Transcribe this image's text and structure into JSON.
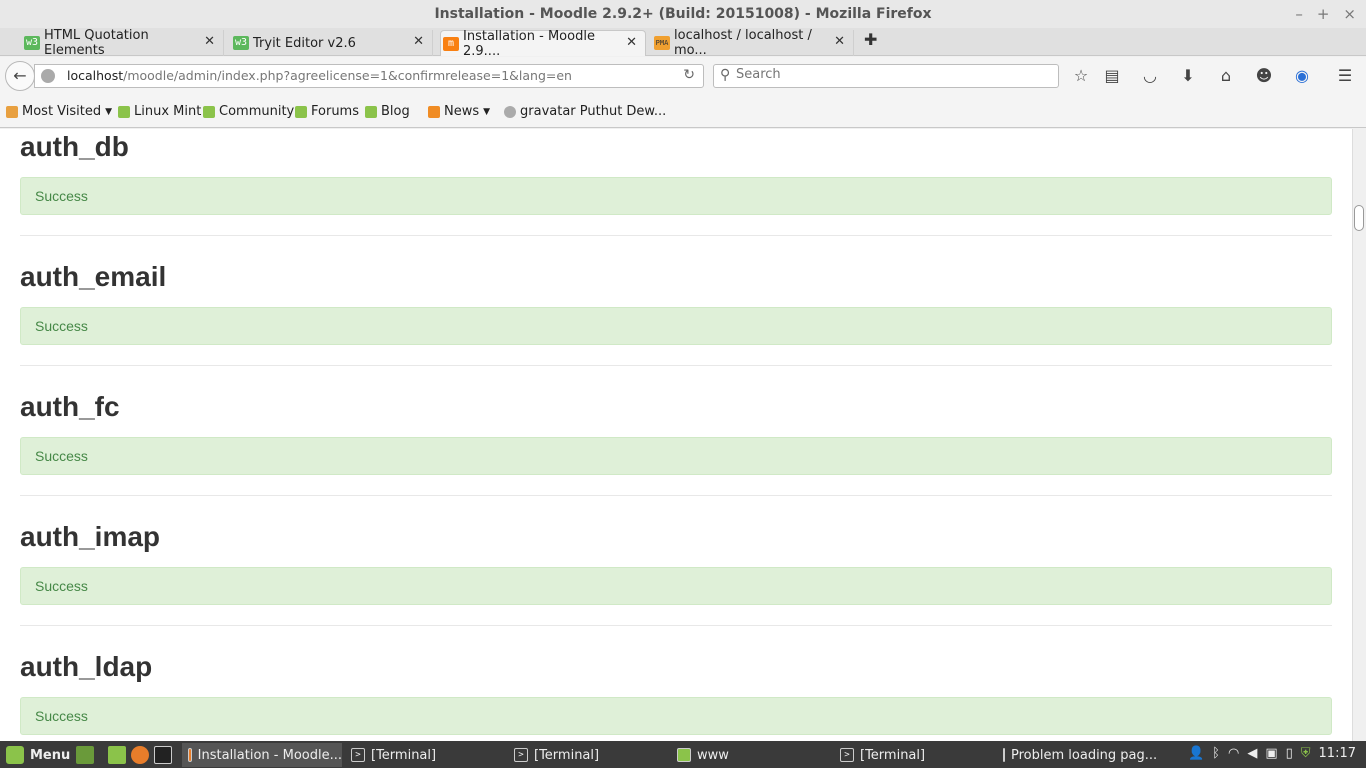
{
  "window": {
    "title": "Installation - Moodle 2.9.2+ (Build: 20151008) - Mozilla Firefox"
  },
  "tabs": [
    {
      "label": "HTML Quotation Elements",
      "icon": "w3-icon"
    },
    {
      "label": "Tryit Editor v2.6",
      "icon": "w3-icon"
    },
    {
      "label": "Installation - Moodle 2.9....",
      "icon": "moodle-icon"
    },
    {
      "label": "localhost / localhost / mo...",
      "icon": "phpmyadmin-icon"
    }
  ],
  "navbar": {
    "url_host": "localhost",
    "url_path": "/moodle/admin/index.php?agreelicense=1&confirmrelease=1&lang=en",
    "search_placeholder": "Search"
  },
  "bookmarks": [
    {
      "label": "Most Visited",
      "icon": "most-visited-icon",
      "dropdown": true
    },
    {
      "label": "Linux Mint",
      "icon": "mint-icon"
    },
    {
      "label": "Community",
      "icon": "mint-icon"
    },
    {
      "label": "Forums",
      "icon": "mint-icon"
    },
    {
      "label": "Blog",
      "icon": "mint-icon"
    },
    {
      "label": "News",
      "icon": "rss-icon",
      "dropdown": true
    },
    {
      "label": "gravatar Puthut Dew...",
      "icon": "globe-icon"
    }
  ],
  "sections": [
    {
      "heading": "auth_db",
      "status": "Success"
    },
    {
      "heading": "auth_email",
      "status": "Success"
    },
    {
      "heading": "auth_fc",
      "status": "Success"
    },
    {
      "heading": "auth_imap",
      "status": "Success"
    },
    {
      "heading": "auth_ldap",
      "status": "Success"
    }
  ],
  "taskbar": {
    "menu_label": "Menu",
    "tasks": [
      {
        "label": "Installation - Moodle...",
        "icon": "firefox-icon"
      },
      {
        "label": "[Terminal]",
        "icon": "terminal-icon"
      },
      {
        "label": "[Terminal]",
        "icon": "terminal-icon"
      },
      {
        "label": "www",
        "icon": "folder-icon"
      },
      {
        "label": "[Terminal]",
        "icon": "terminal-icon"
      },
      {
        "label": "Problem loading pag...",
        "icon": "firefox-icon"
      }
    ],
    "clock": "11:17"
  },
  "colors": {
    "success_bg": "#dff0d8",
    "success_text": "#468847",
    "taskbar_bg": "#3a3a3a"
  }
}
